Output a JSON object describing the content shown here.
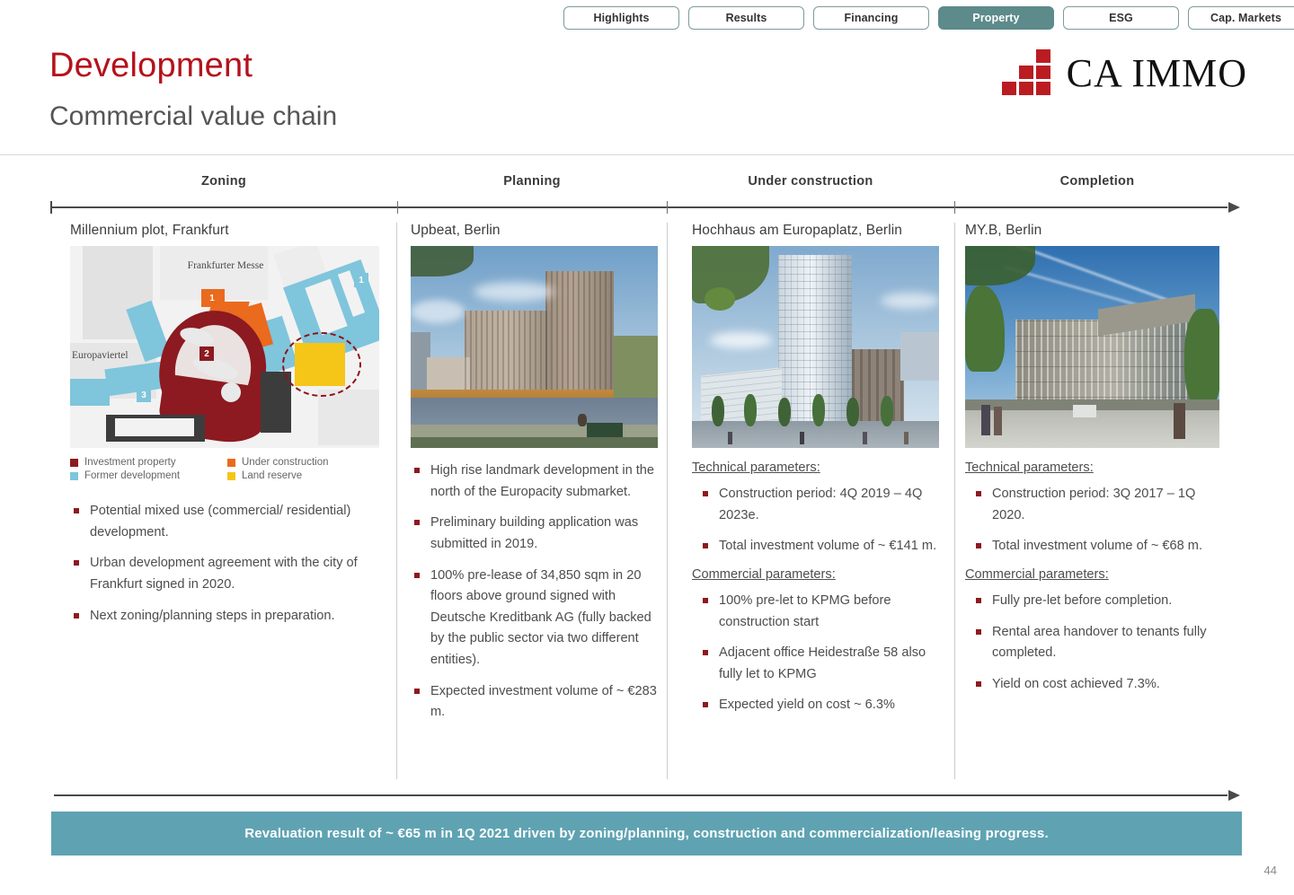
{
  "nav": {
    "items": [
      {
        "label": "Highlights",
        "active": false
      },
      {
        "label": "Results",
        "active": false
      },
      {
        "label": "Financing",
        "active": false
      },
      {
        "label": "Property",
        "active": true
      },
      {
        "label": "ESG",
        "active": false
      },
      {
        "label": "Cap. Markets",
        "active": false
      }
    ]
  },
  "header": {
    "title": "Development",
    "subtitle": "Commercial value chain",
    "logo_text": "CA IMMO",
    "logo_color": "#bb1c22",
    "title_color": "#b5121b"
  },
  "timeline": {
    "phases": [
      "Zoning",
      "Planning",
      "Under construction",
      "Completion"
    ]
  },
  "columns": [
    {
      "title": "Millennium plot, Frankfurt",
      "map": {
        "labels": [
          "Frankfurter Messe",
          "Europaviertel"
        ],
        "markers": [
          "1",
          "2",
          "3",
          "1"
        ],
        "legend": [
          {
            "label": "Investment property",
            "color": "#8c1a20"
          },
          {
            "label": "Under construction",
            "color": "#ea6a1e"
          },
          {
            "label": "Former development",
            "color": "#7fc5dc"
          },
          {
            "label": "Land reserve",
            "color": "#f5c518"
          }
        ]
      },
      "bullets": [
        "Potential mixed use (commercial/ residential) development.",
        "Urban development agreement with the city of Frankfurt signed in 2020.",
        "Next zoning/planning steps in preparation."
      ]
    },
    {
      "title": "Upbeat, Berlin",
      "bullets": [
        "High rise landmark development in the north of the Europacity submarket.",
        "Preliminary building application was submitted in 2019.",
        "100% pre-lease of 34,850 sqm in 20 floors above ground signed with Deutsche Kreditbank AG (fully backed by the public sector via two different entities).",
        "Expected investment volume of ~ €283 m."
      ]
    },
    {
      "title": "Hochhaus am Europaplatz, Berlin",
      "sections": [
        {
          "heading": "Technical parameters:",
          "bullets": [
            "Construction period: 4Q 2019 – 4Q 2023e.",
            "Total investment volume of ~ €141 m."
          ]
        },
        {
          "heading": "Commercial parameters:",
          "bullets": [
            "100% pre-let to KPMG before construction start",
            "Adjacent office Heidestraße 58 also fully let to KPMG",
            "Expected yield on cost ~ 6.3%"
          ]
        }
      ]
    },
    {
      "title": "MY.B, Berlin",
      "sections": [
        {
          "heading": "Technical parameters:",
          "bullets": [
            "Construction period: 3Q 2017 – 1Q 2020.",
            "Total investment volume of ~ €68 m."
          ]
        },
        {
          "heading": "Commercial parameters:",
          "bullets": [
            "Fully pre-let before completion.",
            "Rental area handover to tenants fully completed.",
            "Yield on cost achieved 7.3%."
          ]
        }
      ]
    }
  ],
  "banner": {
    "text": "Revaluation result of ~ €65 m in 1Q 2021 driven by zoning/planning, construction and commercialization/leasing progress.",
    "background": "#5fa3b2"
  },
  "page_number": "44"
}
